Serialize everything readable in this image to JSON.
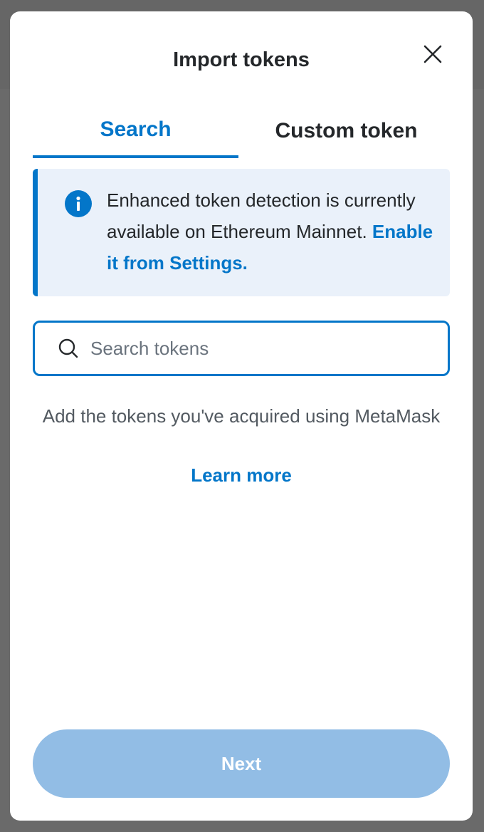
{
  "modal": {
    "title": "Import tokens"
  },
  "tabs": [
    {
      "label": "Search",
      "active": true
    },
    {
      "label": "Custom token",
      "active": false
    }
  ],
  "info": {
    "text": "Enhanced token detection is currently available on Ethereum Mainnet. ",
    "link": "Enable it from Settings."
  },
  "search": {
    "placeholder": "Search tokens",
    "value": ""
  },
  "help": {
    "text": "Add the tokens you've acquired using MetaMask",
    "link": "Learn more"
  },
  "footer": {
    "next_label": "Next"
  },
  "colors": {
    "accent": "#0376c9",
    "info_bg": "#eaf1fa",
    "disabled_button": "#92bde5",
    "overlay": "#6a6a6a"
  },
  "icons": [
    "close-icon",
    "info-icon",
    "search-icon"
  ]
}
